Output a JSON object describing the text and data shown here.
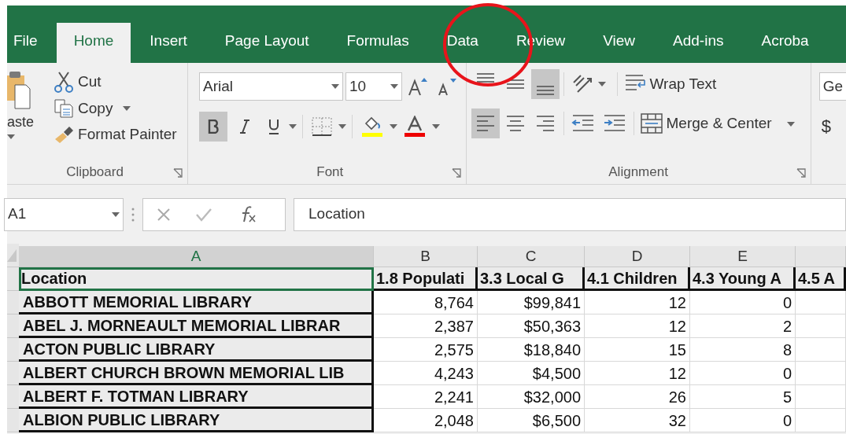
{
  "tabs": [
    {
      "label": "File",
      "selected": false
    },
    {
      "label": "Home",
      "selected": true
    },
    {
      "label": "Insert",
      "selected": false
    },
    {
      "label": "Page Layout",
      "selected": false
    },
    {
      "label": "Formulas",
      "selected": false
    },
    {
      "label": "Data",
      "selected": false
    },
    {
      "label": "Review",
      "selected": false
    },
    {
      "label": "View",
      "selected": false
    },
    {
      "label": "Add-ins",
      "selected": false
    },
    {
      "label": "Acroba",
      "selected": false
    }
  ],
  "clipboard": {
    "paste_label": "aste",
    "cut": "Cut",
    "copy": "Copy",
    "format_painter": "Format Painter",
    "group_label": "Clipboard"
  },
  "font": {
    "name": "Arial",
    "size": "10",
    "bold": true,
    "italic": false,
    "underline": false,
    "group_label": "Font"
  },
  "alignment": {
    "vertical": [
      {
        "kind": "top",
        "selected": false
      },
      {
        "kind": "middle",
        "selected": false
      },
      {
        "kind": "bottom",
        "selected": true
      }
    ],
    "horizontal": [
      {
        "kind": "left",
        "selected": true
      },
      {
        "kind": "center",
        "selected": false
      },
      {
        "kind": "right",
        "selected": false
      }
    ],
    "wrap_text": "Wrap Text",
    "merge_center": "Merge & Center",
    "group_label": "Alignment"
  },
  "number": {
    "format": "Ge",
    "currency": "$"
  },
  "formula_bar": {
    "name_box": "A1",
    "content": "Location"
  },
  "sheet": {
    "columns": [
      {
        "label": "A",
        "selected": true
      },
      {
        "label": "B",
        "selected": false
      },
      {
        "label": "C",
        "selected": false
      },
      {
        "label": "D",
        "selected": false
      },
      {
        "label": "E",
        "selected": false
      }
    ],
    "header_row": [
      {
        "text": "Location",
        "selected": true
      },
      {
        "text": "1.8 Populati",
        "selected": false
      },
      {
        "text": "3.3 Local G",
        "selected": false
      },
      {
        "text": "4.1 Children",
        "selected": false
      },
      {
        "text": "4.3 Young A",
        "selected": false
      },
      {
        "text": "4.5 A",
        "selected": false
      }
    ],
    "rows": [
      [
        "ABBOTT MEMORIAL LIBRARY",
        "8,764",
        "$99,841",
        "12",
        "0"
      ],
      [
        "ABEL J. MORNEAULT MEMORIAL LIBRAR",
        "2,387",
        "$50,363",
        "12",
        "2"
      ],
      [
        "ACTON PUBLIC LIBRARY",
        "2,575",
        "$18,840",
        "15",
        "8"
      ],
      [
        "ALBERT CHURCH BROWN MEMORIAL LIB",
        "4,243",
        "$4,500",
        "12",
        "0"
      ],
      [
        "ALBERT F. TOTMAN LIBRARY",
        "2,241",
        "$32,000",
        "26",
        "5"
      ],
      [
        "ALBION PUBLIC LIBRARY",
        "2,048",
        "$6,500",
        "32",
        "0"
      ]
    ]
  }
}
